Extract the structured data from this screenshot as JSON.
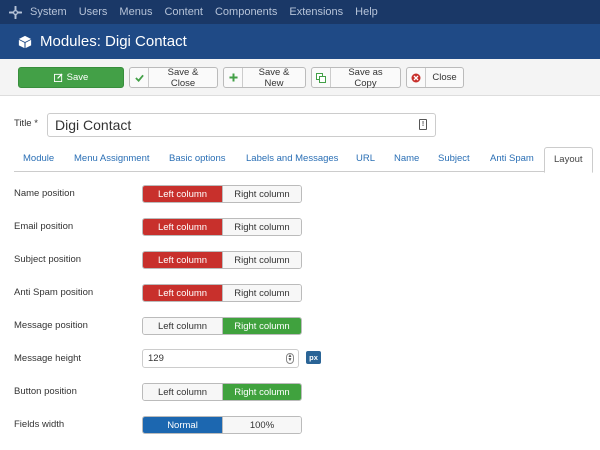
{
  "topnav": {
    "items": [
      "System",
      "Users",
      "Menus",
      "Content",
      "Components",
      "Extensions",
      "Help"
    ]
  },
  "titlebar": {
    "title": "Modules: Digi Contact"
  },
  "toolbar": {
    "save": "Save",
    "save_close": "Save & Close",
    "save_new": "Save & New",
    "save_copy": "Save as Copy",
    "close": "Close"
  },
  "title_field": {
    "label": "Title *",
    "value": "Digi Contact"
  },
  "tabs": [
    "Module",
    "Menu Assignment",
    "Basic options",
    "Labels and Messages",
    "URL",
    "Name",
    "Subject",
    "Anti Spam",
    "Layout"
  ],
  "active_tab": "Layout",
  "fields": {
    "name_position": {
      "label": "Name position",
      "options": [
        "Left column",
        "Right column"
      ],
      "selected": "Left column"
    },
    "email_position": {
      "label": "Email position",
      "options": [
        "Left column",
        "Right column"
      ],
      "selected": "Left column"
    },
    "subject_position": {
      "label": "Subject position",
      "options": [
        "Left column",
        "Right column"
      ],
      "selected": "Left column"
    },
    "antispam_position": {
      "label": "Anti Spam position",
      "options": [
        "Left column",
        "Right column"
      ],
      "selected": "Left column"
    },
    "message_position": {
      "label": "Message position",
      "options": [
        "Left column",
        "Right column"
      ],
      "selected": "Right column"
    },
    "message_height": {
      "label": "Message height",
      "value": "129",
      "unit": "px"
    },
    "button_position": {
      "label": "Button position",
      "options": [
        "Left column",
        "Right column"
      ],
      "selected": "Right column"
    },
    "fields_width": {
      "label": "Fields width",
      "options": [
        "Normal",
        "100%"
      ],
      "selected": "Normal"
    }
  },
  "colors": {
    "nav_bg": "#1a3867",
    "titlebar_bg": "#1f4a86",
    "save_green": "#43a047",
    "selected_red": "#c8302c",
    "selected_green": "#40a23e",
    "selected_blue": "#1c67b0",
    "link_blue": "#2a6fb5"
  }
}
